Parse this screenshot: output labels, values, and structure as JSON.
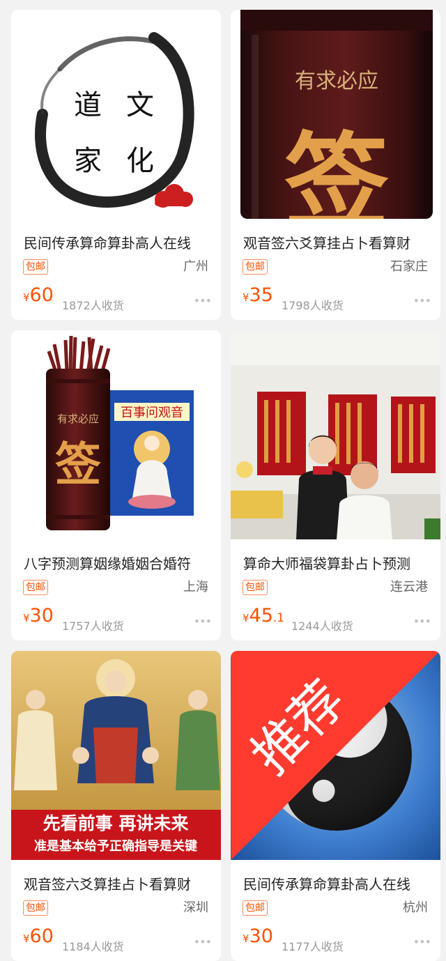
{
  "products": [
    {
      "title": "民间传承算命算卦高人在线",
      "badge": "包邮",
      "location": "广州",
      "currency": "¥",
      "price": "60",
      "price_decimal": "",
      "sales": "1872人收货",
      "image": "daojia-wenhua-logo"
    },
    {
      "title": "观音签六爻算挂占卜看算财",
      "badge": "包邮",
      "location": "石家庄",
      "currency": "¥",
      "price": "35",
      "price_decimal": "",
      "sales": "1798人收货",
      "image": "fortune-stick-tube",
      "image_text": "有求必应",
      "image_big_char": "签"
    },
    {
      "title": "八字预测算姻缘婚姻合婚符",
      "badge": "包邮",
      "location": "上海",
      "currency": "¥",
      "price": "30",
      "price_decimal": "",
      "sales": "1757人收货",
      "image": "fortune-sticks-and-guanyin-book",
      "image_text": "有求必应",
      "image_big_char": "签",
      "book_title": "百事问观音"
    },
    {
      "title": "算命大师福袋算卦占卜预测",
      "badge": "包邮",
      "location": "连云港",
      "currency": "¥",
      "price": "45",
      "price_decimal": ".1",
      "sales": "1244人收货",
      "image": "fortune-teller-photo"
    },
    {
      "title": "观音签六爻算挂占卜看算财",
      "badge": "包邮",
      "location": "深圳",
      "currency": "¥",
      "price": "60",
      "price_decimal": "",
      "sales": "1184人收货",
      "image": "deities-painting",
      "image_line1": "先看前事 再讲未来",
      "image_line2": "准是基本给予正确指导是关键"
    },
    {
      "title": "民间传承算命算卦高人在线",
      "badge": "包邮",
      "location": "杭州",
      "currency": "¥",
      "price": "30",
      "price_decimal": "",
      "sales": "1177人收货",
      "image": "yin-yang-symbol",
      "corner_tag": "推荐"
    }
  ],
  "logo_chars": [
    "道",
    "家",
    "文",
    "化"
  ],
  "more_icon": "more-dots-icon",
  "colors": {
    "accent": "#ff5000",
    "muted": "#999999"
  }
}
